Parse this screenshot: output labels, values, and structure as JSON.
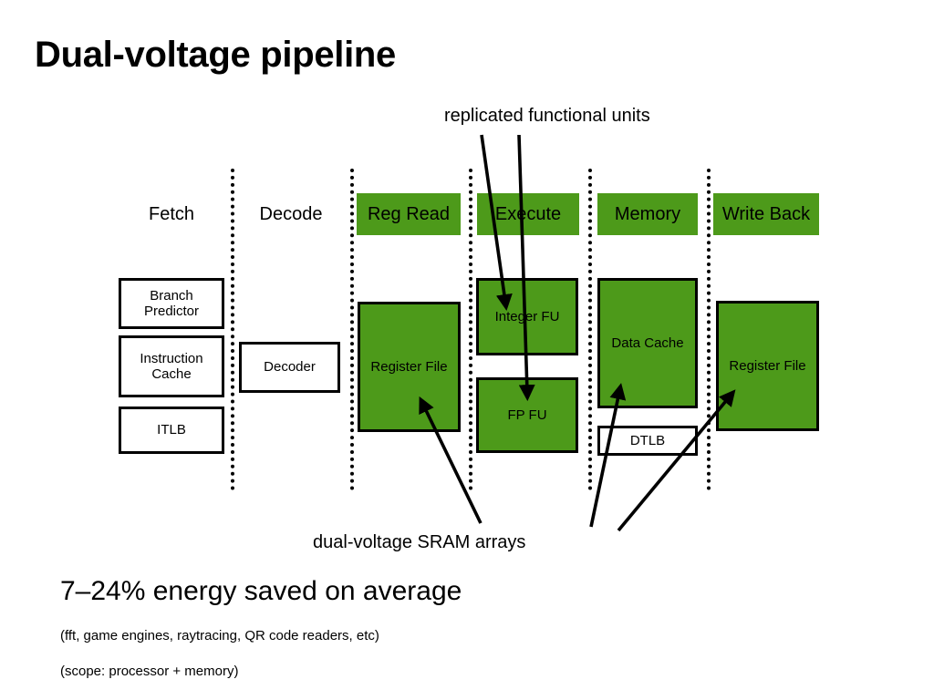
{
  "slide": {
    "title": "Dual-voltage pipeline",
    "annotations": {
      "replicated": "replicated functional units",
      "sram": "dual-voltage SRAM arrays"
    },
    "result": "7–24% energy saved on average",
    "notes": [
      "(fft, game engines, raytracing, QR code readers, etc)",
      "(scope: processor + memory)"
    ]
  },
  "colors": {
    "green": "#4d9a1a",
    "outline": "#000000",
    "background": "#ffffff"
  },
  "pipeline": {
    "stages": [
      {
        "name": "fetch",
        "label": "Fetch",
        "header_highlighted": false,
        "blocks": [
          {
            "name": "branch-predictor",
            "label": "Branch\nPredictor",
            "highlighted": false
          },
          {
            "name": "instruction-cache",
            "label": "Instruction\nCache",
            "highlighted": false
          },
          {
            "name": "itlb",
            "label": "ITLB",
            "highlighted": false
          }
        ]
      },
      {
        "name": "decode",
        "label": "Decode",
        "header_highlighted": false,
        "blocks": [
          {
            "name": "decoder",
            "label": "Decoder",
            "highlighted": false
          }
        ]
      },
      {
        "name": "reg-read",
        "label": "Reg Read",
        "header_highlighted": true,
        "blocks": [
          {
            "name": "register-file",
            "label": "Register File",
            "highlighted": true
          }
        ]
      },
      {
        "name": "execute",
        "label": "Execute",
        "header_highlighted": true,
        "blocks": [
          {
            "name": "integer-fu",
            "label": "Integer FU",
            "highlighted": true
          },
          {
            "name": "fp-fu",
            "label": "FP FU",
            "highlighted": true
          }
        ]
      },
      {
        "name": "memory",
        "label": "Memory",
        "header_highlighted": true,
        "blocks": [
          {
            "name": "data-cache",
            "label": "Data Cache",
            "highlighted": true
          },
          {
            "name": "dtlb",
            "label": "DTLB",
            "highlighted": false
          }
        ]
      },
      {
        "name": "write-back",
        "label": "Write Back",
        "header_highlighted": true,
        "blocks": [
          {
            "name": "register-file-wb",
            "label": "Register File",
            "highlighted": true
          }
        ]
      }
    ]
  },
  "labels": {
    "fetch": "Fetch",
    "decode": "Decode",
    "reg_read": "Reg Read",
    "execute": "Execute",
    "memory": "Memory",
    "write_back": "Write Back",
    "branch_predictor_l1": "Branch",
    "branch_predictor_l2": "Predictor",
    "instruction_cache_l1": "Instruction",
    "instruction_cache_l2": "Cache",
    "itlb": "ITLB",
    "decoder": "Decoder",
    "register_file": "Register File",
    "integer_fu": "Integer FU",
    "fp_fu": "FP FU",
    "data_cache": "Data Cache",
    "dtlb": "DTLB",
    "register_file_wb": "Register File"
  }
}
